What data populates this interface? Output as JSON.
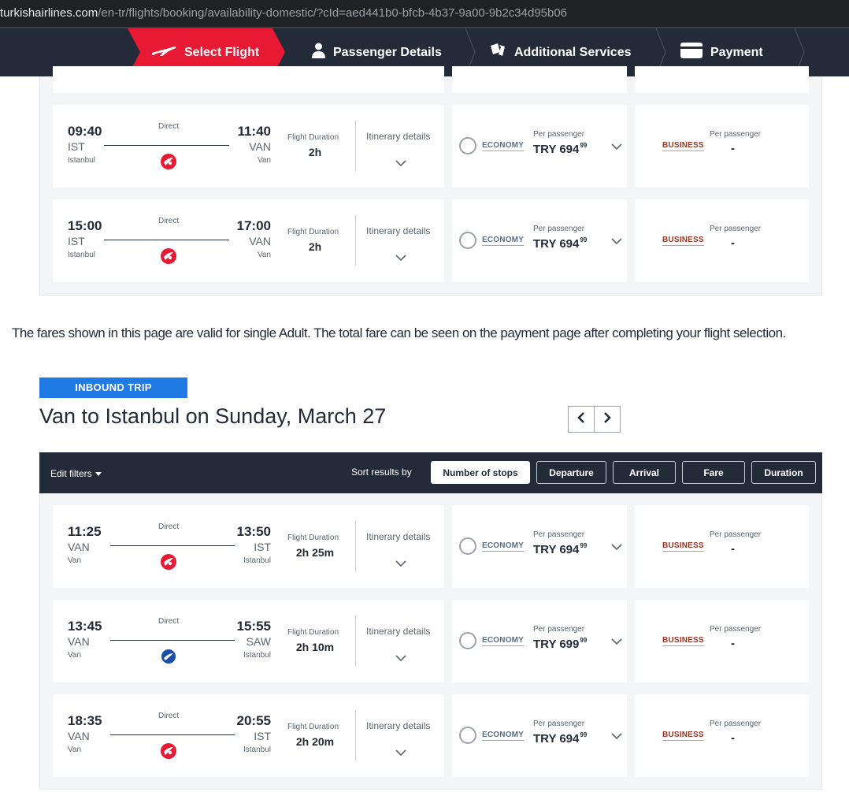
{
  "browser": {
    "url_host": "turkishairlines.com",
    "url_path": "/en-tr/flights/booking/availability-domestic/?cId=aed441b0-bfcb-4b37-9a00-9b2c34d95b06"
  },
  "steps": [
    {
      "label": "Select Flight",
      "icon": "plane-icon",
      "active": true
    },
    {
      "label": "Passenger Details",
      "icon": "person-icon",
      "active": false
    },
    {
      "label": "Additional Services",
      "icon": "services-icon",
      "active": false
    },
    {
      "label": "Payment",
      "icon": "card-icon",
      "active": false
    }
  ],
  "common": {
    "direct": "Direct",
    "flight_duration_label": "Flight Duration",
    "itinerary_label": "Itinerary details",
    "economy_label": "ECONOMY",
    "business_label": "BUSINESS",
    "per_passenger": "Per passenger",
    "business_price": "-"
  },
  "outbound_flights": [
    {
      "dep_time": "09:40",
      "dep_code": "IST",
      "dep_city": "Istanbul",
      "arr_time": "11:40",
      "arr_code": "VAN",
      "arr_city": "Van",
      "duration": "2h",
      "carrier": "thy",
      "price_main": "TRY 694",
      "price_dec": "99"
    },
    {
      "dep_time": "15:00",
      "dep_code": "IST",
      "dep_city": "Istanbul",
      "arr_time": "17:00",
      "arr_code": "VAN",
      "arr_city": "Van",
      "duration": "2h",
      "carrier": "thy",
      "price_main": "TRY 694",
      "price_dec": "99"
    }
  ],
  "notice": "The fares shown in this page are valid for single Adult. The total fare can be seen on the payment page after completing your flight selection.",
  "inbound": {
    "badge": "INBOUND TRIP",
    "title": "Van to Istanbul on Sunday, March 27"
  },
  "sortbar": {
    "edit_filters": "Edit filters",
    "sort_label": "Sort results by",
    "buttons": [
      "Number of stops",
      "Departure",
      "Arrival",
      "Fare",
      "Duration"
    ],
    "active": "Number of stops"
  },
  "inbound_flights": [
    {
      "dep_time": "11:25",
      "dep_code": "VAN",
      "dep_city": "Van",
      "arr_time": "13:50",
      "arr_code": "IST",
      "arr_city": "Istanbul",
      "duration": "2h 25m",
      "carrier": "thy",
      "price_main": "TRY 694",
      "price_dec": "99"
    },
    {
      "dep_time": "13:45",
      "dep_code": "VAN",
      "dep_city": "Van",
      "arr_time": "15:55",
      "arr_code": "SAW",
      "arr_city": "Istanbul",
      "duration": "2h 10m",
      "carrier": "ajet",
      "price_main": "TRY 699",
      "price_dec": "99"
    },
    {
      "dep_time": "18:35",
      "dep_code": "VAN",
      "dep_city": "Van",
      "arr_time": "20:55",
      "arr_code": "IST",
      "arr_city": "Istanbul",
      "duration": "2h 20m",
      "carrier": "thy",
      "price_main": "TRY 694",
      "price_dec": "99"
    }
  ]
}
